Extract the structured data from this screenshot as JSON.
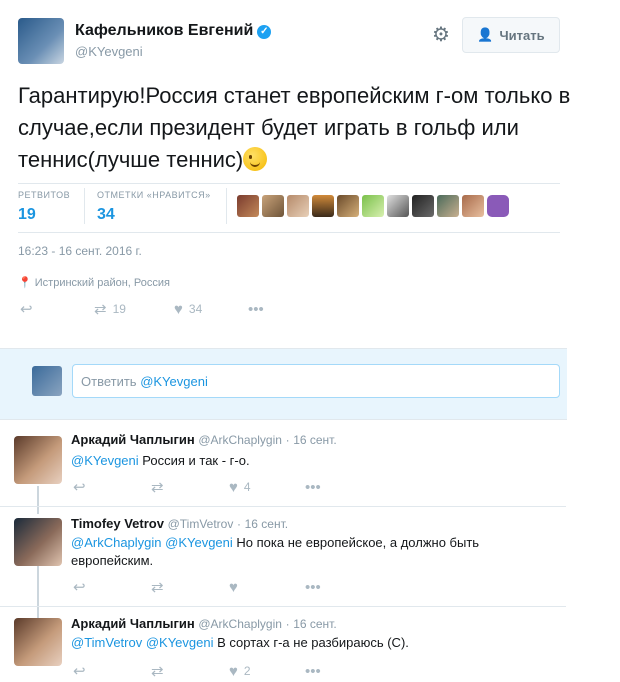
{
  "author": {
    "name": "Кафельников Евгений",
    "handle": "@KYevgeni",
    "verified": true,
    "follow_label": "Читать"
  },
  "tweet": {
    "text": "Гарантирую!Россия станет европейским г-ом только в случае,если президент будет играть в гольф или теннис(лучше теннис)",
    "retweets_label": "РЕТВИТОВ",
    "retweets": "19",
    "likes_label": "ОТМЕТКИ «НРАВИТСЯ»",
    "likes": "34",
    "timestamp": "16:23 - 16 сент. 2016 г.",
    "location": "Истринский район, Россия",
    "action_retweets": "19",
    "action_likes": "34"
  },
  "reply_box": {
    "prefix": "Ответить ",
    "mention": "@KYevgeni"
  },
  "replies": [
    {
      "name": "Аркадий Чаплыгин",
      "handle": "@ArkChaplygin",
      "time": "16 сент.",
      "mentions": "@KYevgeni",
      "text": " Россия и так - г-о.",
      "likes": "4"
    },
    {
      "name": "Timofey Vetrov",
      "handle": "@TimVetrov",
      "time": "16 сент.",
      "mentions": "@ArkChaplygin @KYevgeni",
      "text": " Но пока не европейское, а должно быть европейским.",
      "likes": ""
    },
    {
      "name": "Аркадий Чаплыгин",
      "handle": "@ArkChaplygin",
      "time": "16 сент.",
      "mentions": "@TimVetrov @KYevgeni",
      "text": " В сортах г-а не разбираюсь (С).",
      "likes": "2"
    }
  ],
  "icons": {
    "reply": "reply-icon",
    "retweet": "retweet-icon",
    "like": "heart-icon",
    "more": "more-icon",
    "gear": "gear-icon",
    "location": "location-pin-icon"
  },
  "colors": {
    "accent": "#1b95e0",
    "muted": "#8899a6",
    "verified": "#1da1f2"
  }
}
